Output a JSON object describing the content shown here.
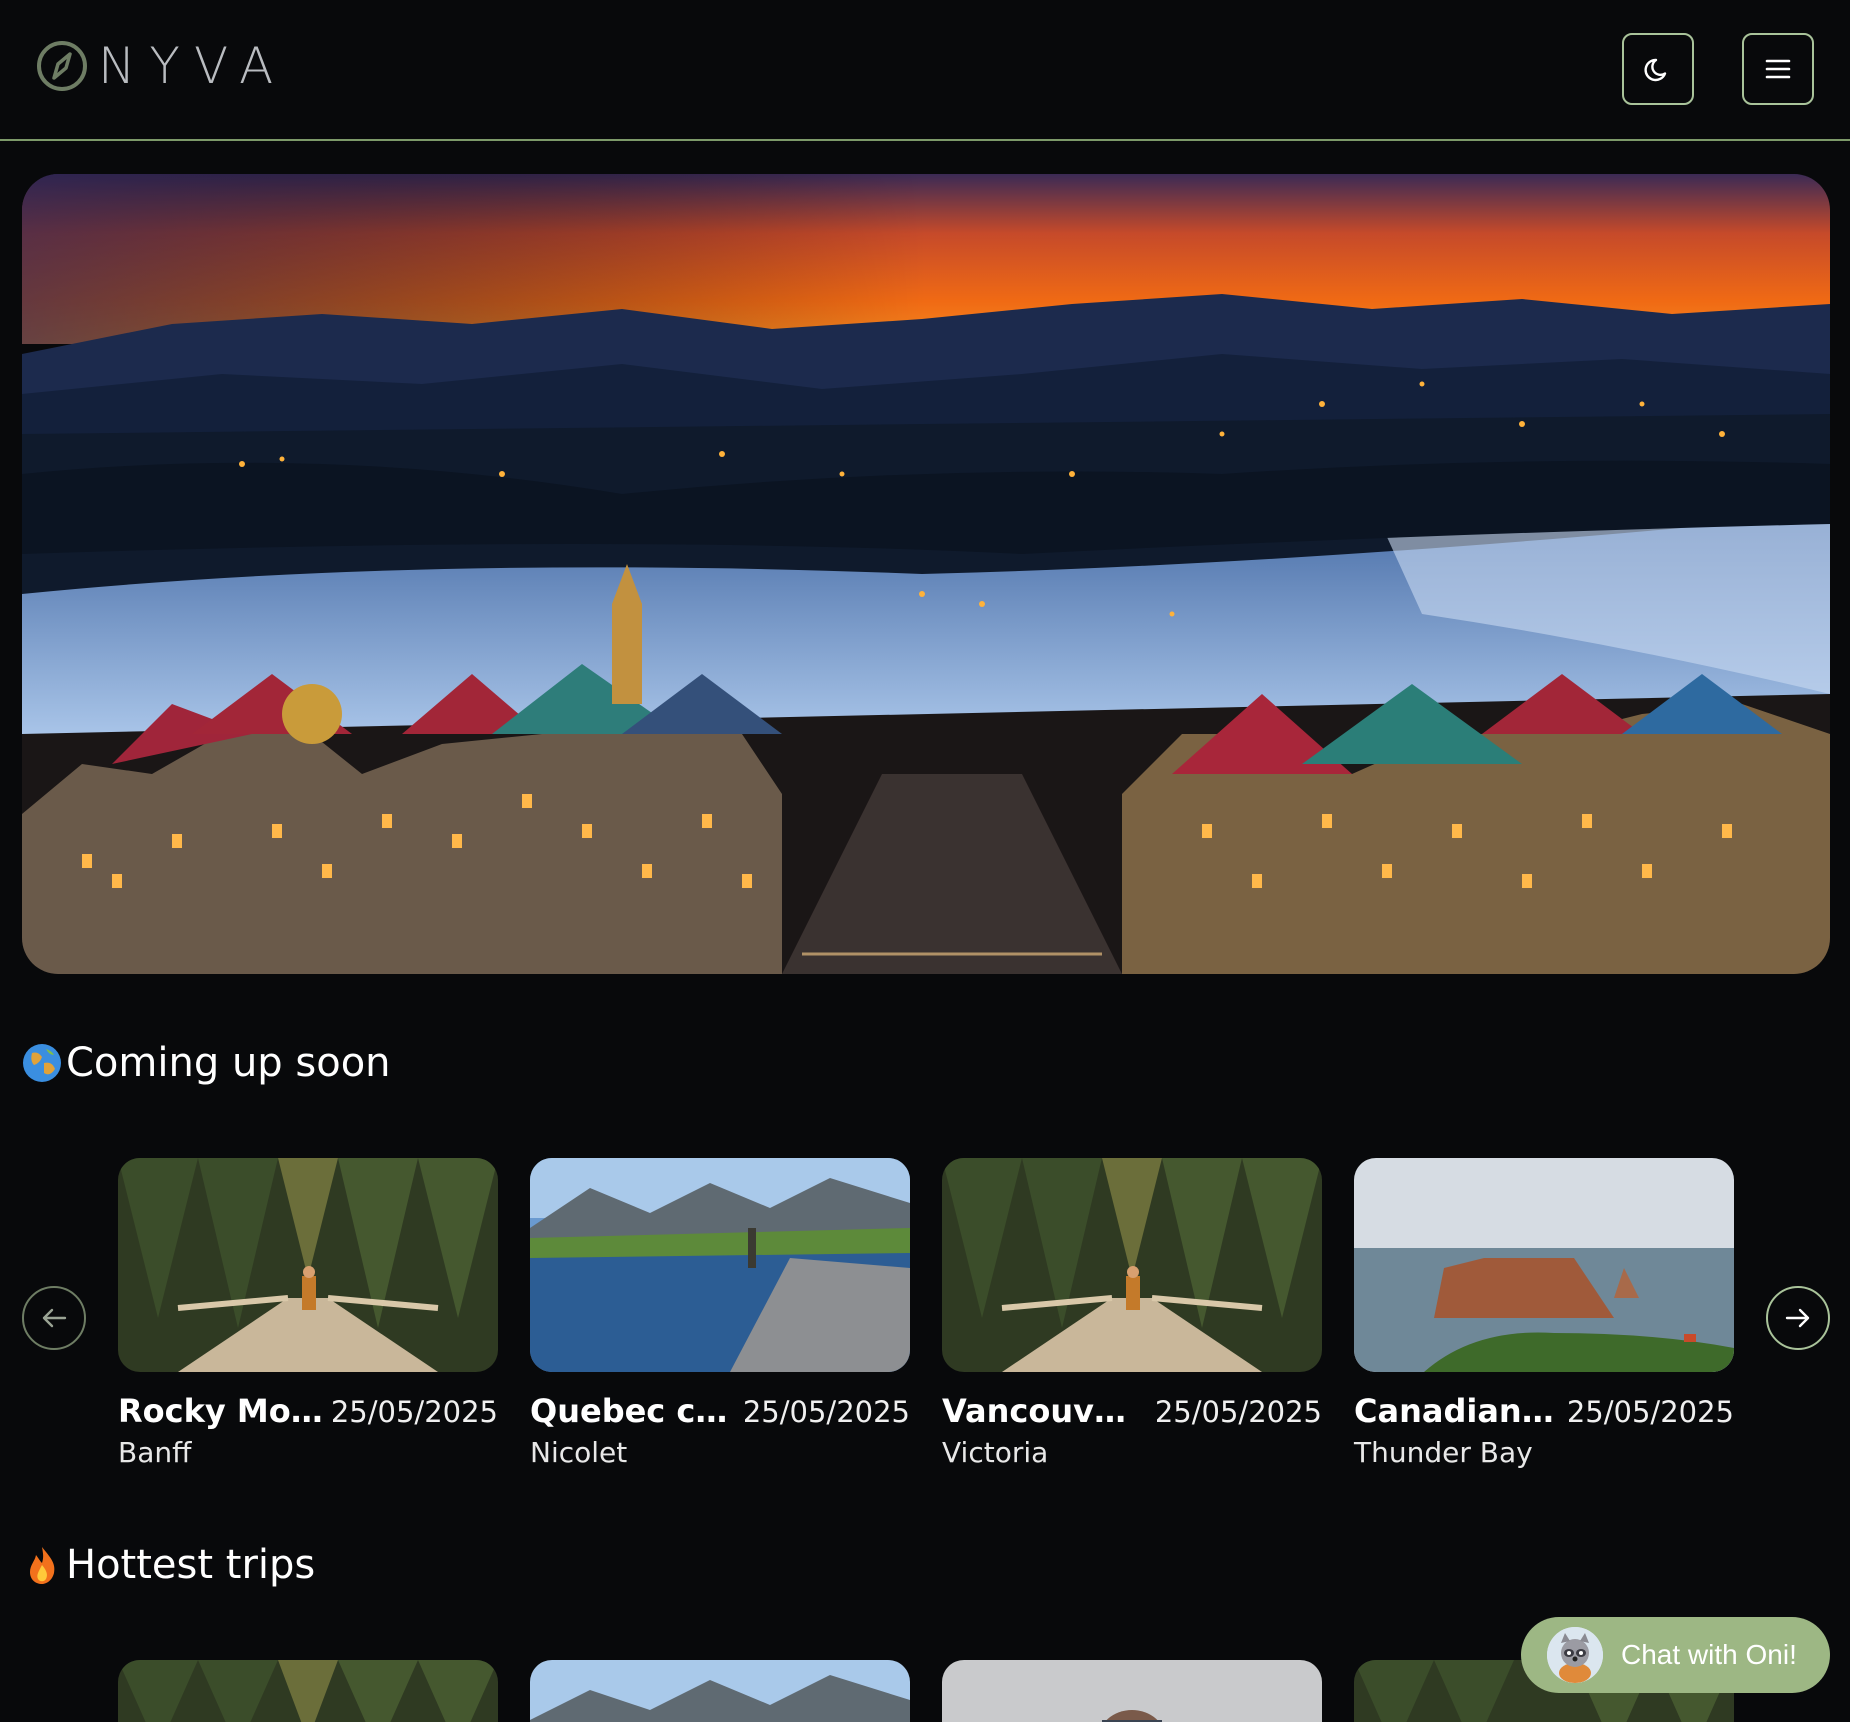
{
  "brand": {
    "logo_text": "NYVA"
  },
  "header": {
    "theme_icon": "moon-icon",
    "menu_icon": "hamburger-menu-icon"
  },
  "hero": {
    "image": "ski-village-night-aerial-photo"
  },
  "sections": [
    {
      "emoji": "globe-emoji",
      "title": "Coming up soon",
      "cards": [
        {
          "title": "Rocky Mou...",
          "date": "25/05/2025",
          "place": "Banff",
          "image": "forest-bridge-hiker"
        },
        {
          "title": "Quebec ca...",
          "date": "25/05/2025",
          "place": "Nicolet",
          "image": "river-fisherman-mountains"
        },
        {
          "title": "Vancouver I...",
          "date": "25/05/2025",
          "place": "Victoria",
          "image": "forest-bridge-hiker"
        },
        {
          "title": "Canadian S...",
          "date": "25/05/2025",
          "place": "Thunder Bay",
          "image": "sea-rock-cliff"
        }
      ]
    },
    {
      "emoji": "fire-emoji",
      "title": "Hottest trips",
      "cards": [
        {
          "image": "forest-bridge-hiker"
        },
        {
          "image": "river-fisherman-mountains"
        },
        {
          "image": "hiker-snowy-portrait"
        },
        {
          "image": "forest-bridge-hiker"
        }
      ]
    }
  ],
  "carousel": {
    "prev_icon": "arrow-left-icon",
    "next_icon": "arrow-right-icon"
  },
  "chat": {
    "label": "Chat with Oni!",
    "avatar": "raccoon-avatar"
  },
  "colors": {
    "background": "#08090b",
    "accent": "#9db784",
    "border": "#7d9a6a"
  }
}
